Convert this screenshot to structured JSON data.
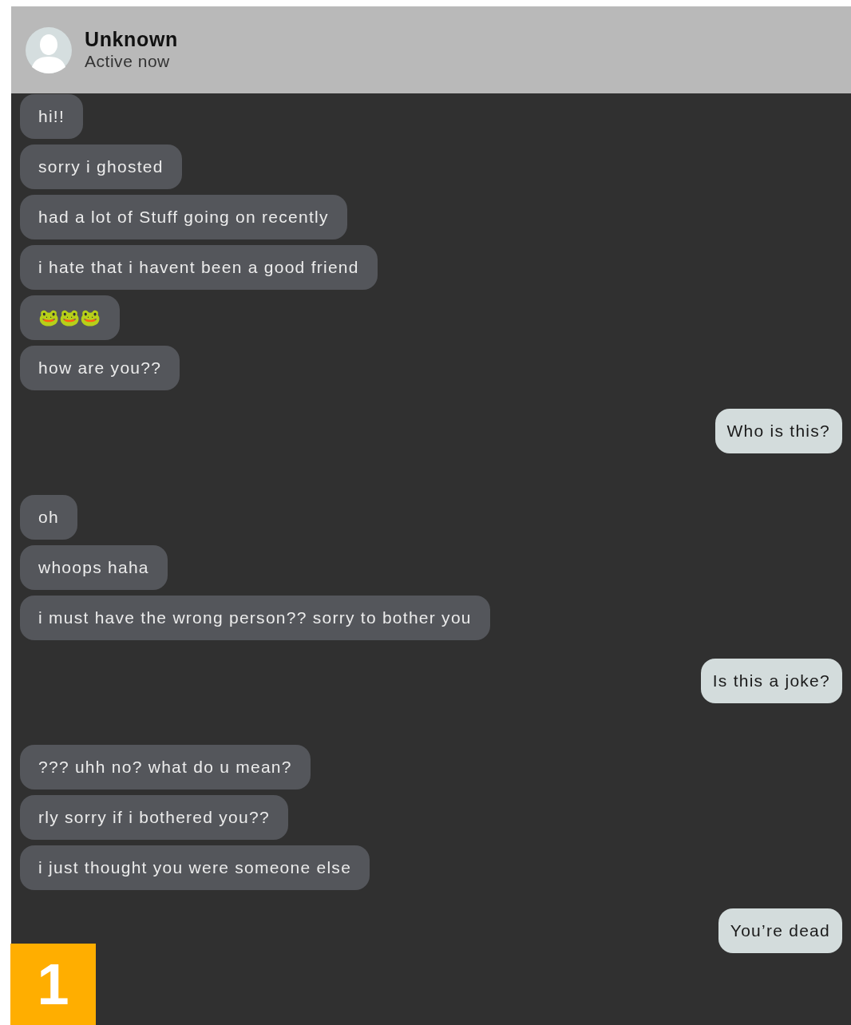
{
  "header": {
    "name": "Unknown",
    "status": "Active now"
  },
  "messages": [
    {
      "outgoing": false,
      "kind": "text",
      "text": "hi!!"
    },
    {
      "outgoing": false,
      "kind": "text",
      "text": "sorry i ghosted"
    },
    {
      "outgoing": false,
      "kind": "text",
      "text": "had a lot of Stuff going on recently"
    },
    {
      "outgoing": false,
      "kind": "text",
      "text": "i hate that i havent been a good friend"
    },
    {
      "outgoing": false,
      "kind": "emoji",
      "text": "🐸🐸🐸"
    },
    {
      "outgoing": false,
      "kind": "text",
      "text": "how are you??"
    },
    {
      "outgoing": true,
      "kind": "text",
      "text": "Who is this?"
    },
    {
      "outgoing": false,
      "kind": "text",
      "text": "oh"
    },
    {
      "outgoing": false,
      "kind": "text",
      "text": "whoops haha"
    },
    {
      "outgoing": false,
      "kind": "text",
      "text": "i must have the wrong person?? sorry to bother you"
    },
    {
      "outgoing": true,
      "kind": "text",
      "text": "Is this a joke?"
    },
    {
      "outgoing": false,
      "kind": "text",
      "text": "??? uhh no? what do u mean?"
    },
    {
      "outgoing": false,
      "kind": "text",
      "text": "rly sorry if i bothered you??"
    },
    {
      "outgoing": false,
      "kind": "text",
      "text": "i just thought you were someone else"
    },
    {
      "outgoing": true,
      "kind": "text",
      "text": "You’re dead"
    }
  ],
  "page_badge": "1"
}
